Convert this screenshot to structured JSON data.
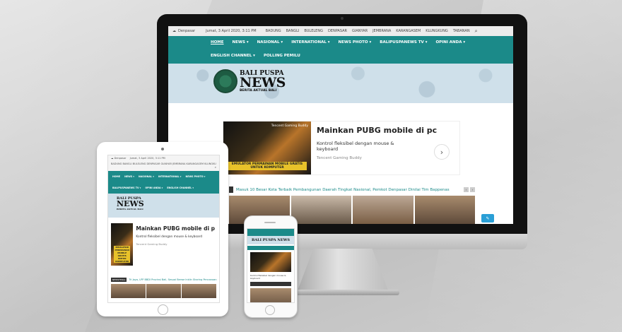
{
  "desktop": {
    "topbar": {
      "city": "Denpasar",
      "date": "Jumat, 3 April 2020, 3:11 PM",
      "regions": [
        "BADUNG",
        "BANGLI",
        "BULELENG",
        "DENPASAR",
        "GIANYAR",
        "JEMBRANA",
        "KARANGASEM",
        "KLUNGKUNG",
        "TABANAN"
      ]
    },
    "nav": [
      "HOME",
      "NEWS ▾",
      "NASIONAL ▾",
      "INTERNATIONAL ▾",
      "NEWS PHOTO ▾",
      "BALIPUSPANEWS TV ▾",
      "OPINI ANDA ▾",
      "ENGLISH CHANNEL ▾",
      "POLLING PEMILU"
    ],
    "logo": {
      "line1": "BALI PUSPA",
      "line2": "NEWS",
      "tagline": "BERITA AKTUAL BALI"
    },
    "ad": {
      "headline": "Mainkan PUBG mobile di pc",
      "body": "Kontrol fleksibel dengan mouse & keyboard",
      "sponsor": "Tencent Gaming Buddy",
      "image_caption": "EMULATOR PERMAINAN MOBILE GRATIS UNTUK KOMPUTER",
      "image_brand": "Tencent Gaming Buddy"
    },
    "ticker": {
      "text": "Masuk 10 Besar Kota Terbaik Pembangunan Daerah Tingkat Nasional, Pemkot Denpasar Dinilai Tim Bappenas"
    }
  },
  "tablet": {
    "city": "Denpasar",
    "date": "Jumat, 3 April 2020, 3:11 PM",
    "regions": "BADUNG  BANGLI  BULELENG  DENPASAR  GIANYAR  JEMBRANA  KARANGASEM  KLUNGKUNG  TABANAN",
    "nav": [
      "HOME",
      "NEWS ▾",
      "NASIONAL ▾",
      "INTERNATIONAL ▾",
      "NEWS PHOTO ▾",
      "BALIPUSPANEWS TV ▾",
      "OPINI ANDA ▾",
      "ENGLISH CHANNEL ▾",
      "POLLING PEMILU"
    ],
    "logo": {
      "line1": "BALI PUSPA",
      "line2": "NEWS",
      "tagline": "BERITA AKTUAL BALI"
    },
    "ad": {
      "headline": "Mainkan PUBG mobile di p",
      "body": "Kontrol fleksibel dengan mouse & keyboard",
      "sponsor": "Tencent Gaming Buddy",
      "image_caption": "EMULATOR PERMAINAN MOBILE GRATIS UNTUK KOMPUTER"
    },
    "ticker": {
      "tag": "NEWSTERAL",
      "text": "Tri Jaya, LPP BBDI Provinsi Bali, Sesuai Berwe Inklin Sharing Pencanaan"
    }
  },
  "phone": {
    "logo": "BALI PUSPA NEWS",
    "text": "Kontrol fleksibel dengan mouse & keyboard"
  }
}
